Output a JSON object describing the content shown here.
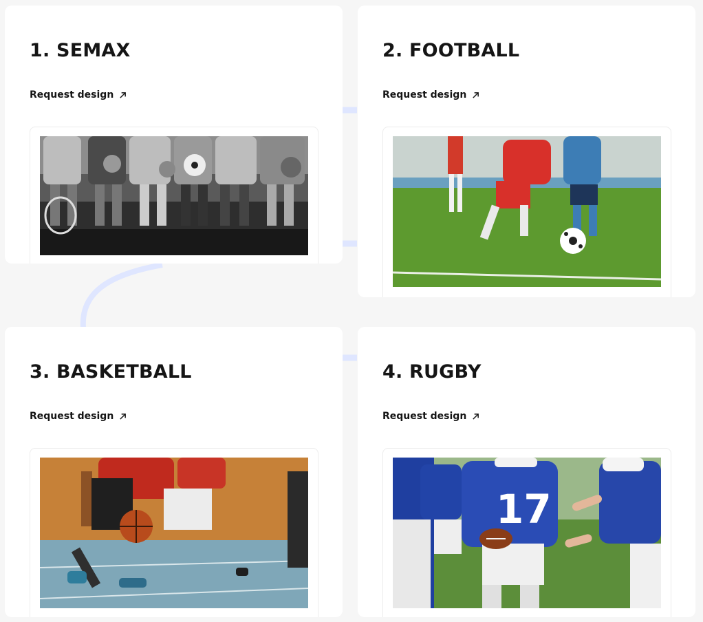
{
  "cards": [
    {
      "title": "1. SEMAX",
      "link_label": "Request design",
      "link_icon": "arrow-up-right-icon",
      "image": "grayscale photo of athletes sitting on a bench holding balls and rackets"
    },
    {
      "title": "2. FOOTBALL",
      "link_label": "Request design",
      "link_icon": "arrow-up-right-icon",
      "image": "photo of kids playing football on green grass"
    },
    {
      "title": "3. BASKETBALL",
      "link_label": "Request design",
      "link_icon": "arrow-up-right-icon",
      "image": "photo of basketball players dribbling in indoor court"
    },
    {
      "title": "4. RUGBY",
      "link_label": "Request design",
      "link_icon": "arrow-up-right-icon",
      "image": "photo of kids in blue jerseys playing american football"
    }
  ],
  "colors": {
    "background": "#f6f6f6",
    "card": "#ffffff",
    "text": "#151515",
    "connector": "#dfe6ff"
  }
}
